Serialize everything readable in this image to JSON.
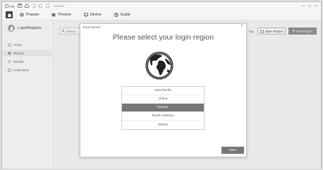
{
  "titlebar": {
    "file_label": "File",
    "app_title": "Untitled",
    "minimize": "—",
    "maximize": "□",
    "close": "×"
  },
  "menubar": {
    "items": [
      {
        "label": "Prepare",
        "icon": "gear-icon"
      },
      {
        "label": "Preview",
        "icon": "layers-icon"
      },
      {
        "label": "Device",
        "icon": "monitor-icon"
      },
      {
        "label": "Guide",
        "icon": "help-icon"
      }
    ]
  },
  "sidebar": {
    "login_label": "Login/Register",
    "items": [
      {
        "label": "Home",
        "icon": "home-icon",
        "active": false
      },
      {
        "label": "Recent",
        "icon": "clock-icon",
        "active": true
      },
      {
        "label": "Models",
        "icon": "cube-icon",
        "active": false
      },
      {
        "label": "Collections",
        "icon": "folder-icon",
        "active": false
      }
    ]
  },
  "main": {
    "search_value": "plant p",
    "partial_button": "ing",
    "open_project": "Open Project",
    "new_project": "New Project"
  },
  "dialog": {
    "title": "Setup Wizard",
    "close": "×",
    "heading": "Please select your login region",
    "regions": [
      "Asia Pacific",
      "China",
      "Europe",
      "North America",
      "Others"
    ],
    "selected_region": "Europe",
    "next_label": "Next"
  },
  "colors": {
    "selected_bg": "#777777",
    "primary_button": "#8e8e8e",
    "home_button": "#3e3e3e"
  }
}
